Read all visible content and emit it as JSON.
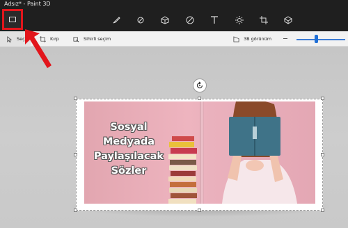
{
  "window": {
    "title": "Adsız* - Paint 3D"
  },
  "toolbar": {
    "menu_icon": "menu-icon",
    "tools": [
      {
        "name": "brushes",
        "icon": "brush-icon"
      },
      {
        "name": "2d-shapes",
        "icon": "2d-shapes-icon"
      },
      {
        "name": "3d-shapes",
        "icon": "3d-shapes-icon"
      },
      {
        "name": "stickers",
        "icon": "stickers-icon"
      },
      {
        "name": "text",
        "icon": "text-icon"
      },
      {
        "name": "effects",
        "icon": "effects-icon"
      },
      {
        "name": "canvas",
        "icon": "canvas-icon"
      },
      {
        "name": "3d-library",
        "icon": "3d-library-icon"
      }
    ]
  },
  "subtoolbar": {
    "select_label": "Seç",
    "crop_label": "Kırp",
    "magic_select_label": "Sihirli seçim",
    "view3d_label": "3B görünüm"
  },
  "canvas": {
    "headline_lines": [
      "Sosyal",
      "Medyada",
      "Paylaşılacak",
      "Sözler"
    ]
  },
  "annotation": {
    "highlight_color": "#e2161c"
  },
  "colors": {
    "accent": "#1f6fd6",
    "toolbar_bg": "#1f1f1f"
  }
}
